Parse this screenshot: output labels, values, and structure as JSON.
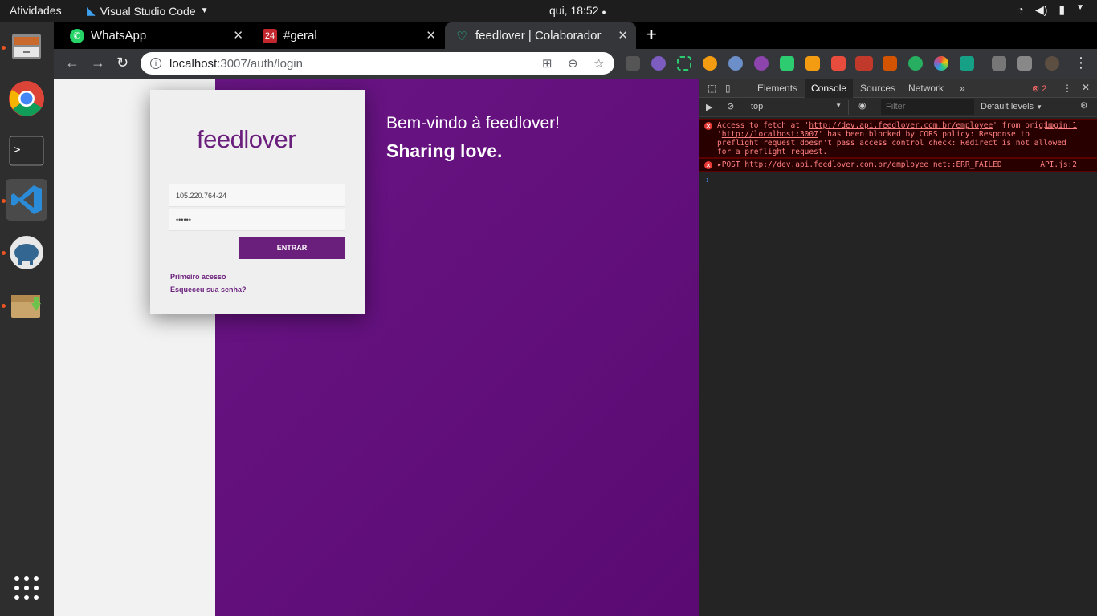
{
  "topbar": {
    "activities": "Atividades",
    "app_name": "Visual Studio Code",
    "clock": "qui, 18:52"
  },
  "dock": {
    "items": [
      "files-icon",
      "chrome-icon",
      "terminal-icon",
      "vscode-icon",
      "postgres-icon",
      "archive-icon"
    ],
    "show_apps": "show-apps-icon"
  },
  "tabs": [
    {
      "label": "WhatsApp",
      "close": "✕"
    },
    {
      "label": "#geral",
      "close": "✕"
    },
    {
      "label": "feedlover | Colaborador",
      "close": "✕"
    }
  ],
  "toolbar": {
    "url_host": "localhost",
    "url_path": ":3007/auth/login"
  },
  "login": {
    "logo": "feedlover",
    "cpf_value": "105.220.764-24",
    "password_value": "••••••",
    "submit_label": "ENTRAR",
    "first_access": "Primeiro acesso",
    "forgot_password": "Esqueceu sua senha?"
  },
  "hero": {
    "welcome": "Bem-vindo à feedlover!",
    "tagline": "Sharing love."
  },
  "devtools": {
    "tabs": [
      "Elements",
      "Console",
      "Sources",
      "Network"
    ],
    "more": "»",
    "error_count": "2",
    "context": "top",
    "filter_placeholder": "Filter",
    "levels": "Default levels",
    "messages": [
      {
        "text_prefix": "Access to fetch at '",
        "url": "http://dev.api.feedlover.com.br/employee",
        "text_mid": "' from origin '",
        "origin": "http://localhost:3007",
        "text_suffix": "' has been blocked by CORS policy: Response to preflight request doesn't pass access control check: Redirect is not allowed for a preflight request.",
        "source": "login:1"
      },
      {
        "method": "▸POST",
        "url": "http://dev.api.feedlover.com.br/employee",
        "status": "net::ERR_FAILED",
        "source": "API.js:2"
      }
    ],
    "prompt": "›"
  },
  "colors": {
    "brand": "#6b1f7c",
    "error": "#ff8080"
  }
}
